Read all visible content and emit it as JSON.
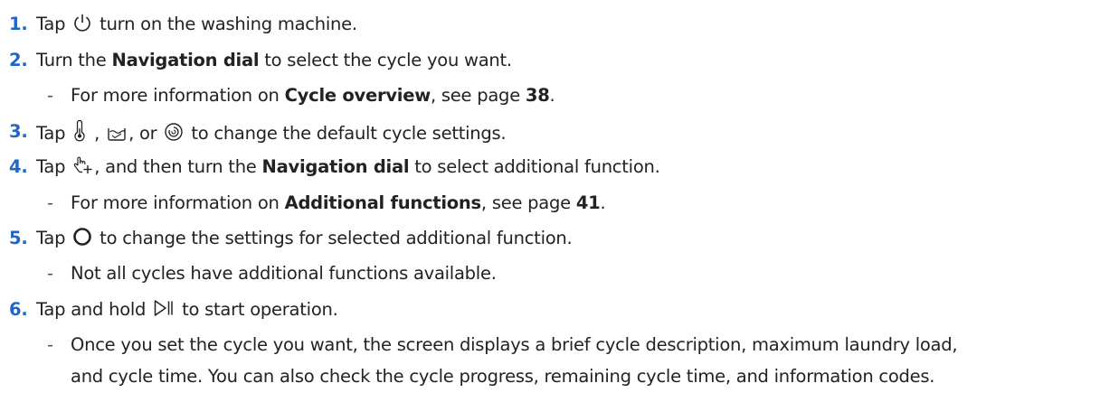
{
  "steps": [
    {
      "number": "1.",
      "pre": "Tap ",
      "icon": "power-icon",
      "post": " turn on the washing machine."
    },
    {
      "number": "2.",
      "pre": "Turn the ",
      "bold": "Navigation dial",
      "post": " to select the cycle you want.",
      "sub": {
        "dash": "-",
        "pre": "For more information on ",
        "bold": "Cycle overview",
        "mid": ", see page ",
        "page": "38",
        "end": "."
      }
    },
    {
      "number": "3.",
      "pre": "Tap ",
      "icons": [
        "thermometer-icon",
        "rinse-basin-icon",
        "spin-icon"
      ],
      "sep1": " , ",
      "sep2": ", or ",
      "post": " to change the default cycle settings."
    },
    {
      "number": "4.",
      "pre": "Tap ",
      "icon": "hand-plus-icon",
      "mid": ", and then turn the ",
      "bold": "Navigation dial",
      "post": " to select additional function.",
      "sub": {
        "dash": "-",
        "pre": "For more information on ",
        "bold": "Additional functions",
        "mid": ", see page ",
        "page": "41",
        "end": "."
      }
    },
    {
      "number": "5.",
      "pre": "Tap ",
      "icon": "circle-ok-icon",
      "post": " to change the settings for selected additional function.",
      "sub": {
        "dash": "-",
        "text": "Not all cycles have additional functions available."
      }
    },
    {
      "number": "6.",
      "pre": "Tap and hold ",
      "icon": "start-pause-icon",
      "post": " to start operation.",
      "sub": {
        "dash": "-",
        "line1": "Once you set the cycle you want, the screen displays a brief cycle description, maximum laundry load,",
        "line2": "and cycle time. You can also check the cycle progress, remaining cycle time, and information codes."
      }
    }
  ],
  "colors": {
    "step_number": "#1e66c8",
    "text": "#222222"
  }
}
